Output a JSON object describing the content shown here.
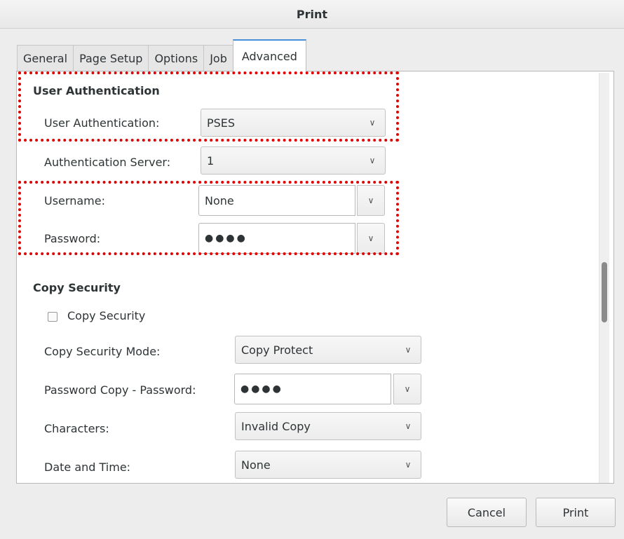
{
  "window": {
    "title": "Print"
  },
  "tabs": [
    {
      "label": "General"
    },
    {
      "label": "Page Setup"
    },
    {
      "label": "Options"
    },
    {
      "label": "Job"
    },
    {
      "label": "Advanced"
    }
  ],
  "user_auth": {
    "heading": "User Authentication",
    "user_authentication_label": "User Authentication:",
    "user_authentication_value": "PSES",
    "server_label": "Authentication Server:",
    "server_value": "1",
    "username_label": "Username:",
    "username_value": "None",
    "password_label": "Password:",
    "password_value": "●●●●"
  },
  "copy_security": {
    "heading": "Copy Security",
    "checkbox_label": "Copy Security",
    "checkbox_checked": false,
    "mode_label": "Copy Security Mode:",
    "mode_value": "Copy Protect",
    "pw_copy_label": "Password Copy - Password:",
    "pw_copy_value": "●●●●",
    "characters_label": "Characters:",
    "characters_value": "Invalid Copy",
    "datetime_label": "Date and Time:",
    "datetime_value": "None"
  },
  "buttons": {
    "cancel": "Cancel",
    "print": "Print"
  },
  "icons": {
    "dropdown": "chevron-down-icon"
  },
  "colors": {
    "highlight": "#e00000",
    "active_tab": "#4a90d9"
  },
  "scroll_position_fraction": 0.46
}
